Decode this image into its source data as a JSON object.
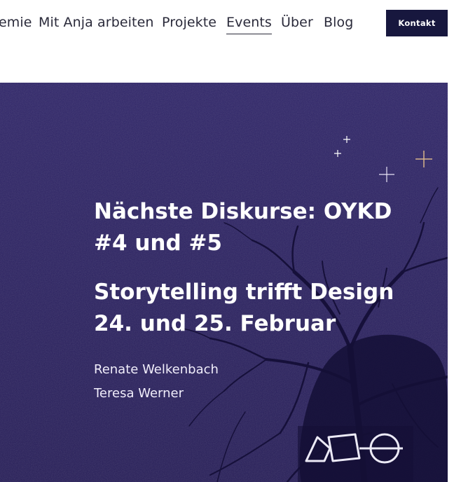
{
  "nav": {
    "items": [
      {
        "label": "emie",
        "active": false
      },
      {
        "label": "Mit Anja arbeiten",
        "active": false
      },
      {
        "label": "Projekte",
        "active": false
      },
      {
        "label": "Events",
        "active": true
      },
      {
        "label": "Über",
        "active": false
      },
      {
        "label": "Blog",
        "active": false
      }
    ],
    "contact_label": "Kontakt"
  },
  "hero": {
    "title": "Nächste Diskurse: OYKD #4 und #5",
    "subtitle": "Storytelling trifft Design 24. und 25. Februar",
    "speakers": [
      "Renate Welkenbach",
      "Teresa Werner"
    ],
    "logo_icon": "geometric-shapes-logo-icon"
  },
  "colors": {
    "nav_text": "#2a2a3a",
    "button_bg": "#17173e",
    "hero_bg": "#2e2468",
    "star_accent": "#d8b48a"
  }
}
